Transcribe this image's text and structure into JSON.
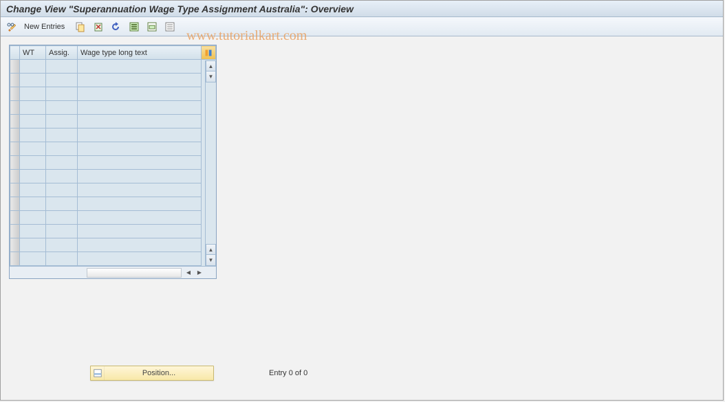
{
  "header": {
    "title": "Change View \"Superannuation Wage Type Assignment Australia\": Overview"
  },
  "toolbar": {
    "new_entries_label": "New Entries"
  },
  "watermark": "www.tutorialkart.com",
  "table": {
    "columns": {
      "wt": "WT",
      "assig": "Assig.",
      "wage_long": "Wage type long text"
    },
    "rows": [
      {
        "wt": "",
        "assig": "",
        "wage_long": ""
      },
      {
        "wt": "",
        "assig": "",
        "wage_long": ""
      },
      {
        "wt": "",
        "assig": "",
        "wage_long": ""
      },
      {
        "wt": "",
        "assig": "",
        "wage_long": ""
      },
      {
        "wt": "",
        "assig": "",
        "wage_long": ""
      },
      {
        "wt": "",
        "assig": "",
        "wage_long": ""
      },
      {
        "wt": "",
        "assig": "",
        "wage_long": ""
      },
      {
        "wt": "",
        "assig": "",
        "wage_long": ""
      },
      {
        "wt": "",
        "assig": "",
        "wage_long": ""
      },
      {
        "wt": "",
        "assig": "",
        "wage_long": ""
      },
      {
        "wt": "",
        "assig": "",
        "wage_long": ""
      },
      {
        "wt": "",
        "assig": "",
        "wage_long": ""
      },
      {
        "wt": "",
        "assig": "",
        "wage_long": ""
      },
      {
        "wt": "",
        "assig": "",
        "wage_long": ""
      },
      {
        "wt": "",
        "assig": "",
        "wage_long": ""
      }
    ]
  },
  "footer": {
    "position_label": "Position...",
    "entry_status": "Entry 0 of 0"
  }
}
